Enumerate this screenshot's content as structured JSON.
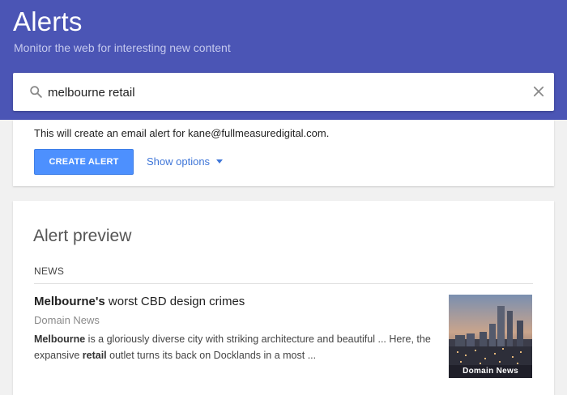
{
  "header": {
    "title": "Alerts",
    "subtitle": "Monitor the web for interesting new content",
    "background_color": "#4b55b5"
  },
  "search": {
    "value": "melbourne retail",
    "search_icon": "search-icon",
    "clear_icon": "close-icon"
  },
  "create": {
    "description": "This will create an email alert for kane@fullmeasuredigital.com.",
    "button_label": "CREATE ALERT",
    "button_color": "#4d90fe",
    "options_label": "Show options",
    "options_icon": "caret-down-icon"
  },
  "preview": {
    "title": "Alert preview",
    "section_label": "NEWS",
    "items": [
      {
        "title_bold": "Melbourne's",
        "title_rest": " worst CBD design crimes",
        "source": "Domain News",
        "snippet": [
          {
            "text": "Melbourne",
            "bold": true
          },
          {
            "text": " is a gloriously diverse city with striking architecture and beautiful ... Here, the expansive ",
            "bold": false
          },
          {
            "text": "retail",
            "bold": true
          },
          {
            "text": " outlet turns its back on Docklands in a most ...",
            "bold": false
          }
        ],
        "thumbnail_caption": "Domain News"
      }
    ]
  }
}
